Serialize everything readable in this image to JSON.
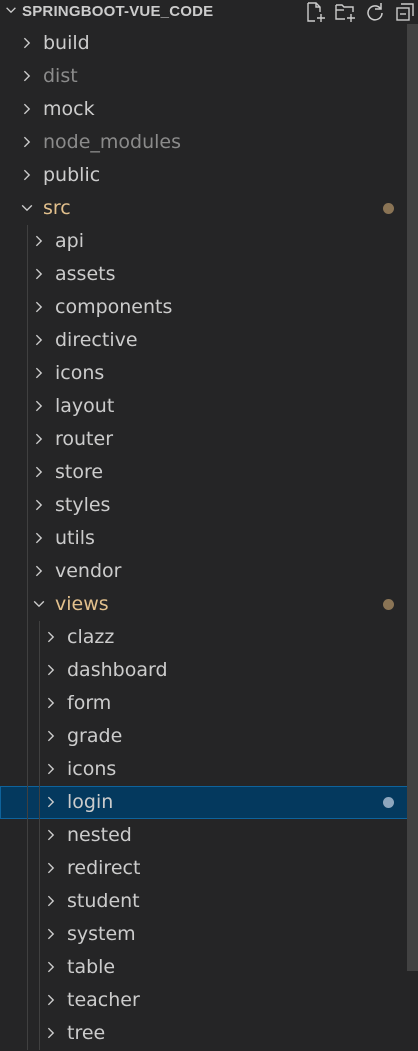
{
  "explorer": {
    "title": "SPRINGBOOT-VUE_CODE",
    "actions": [
      "new-file-icon",
      "new-folder-icon",
      "refresh-icon",
      "collapse-all-icon"
    ]
  },
  "tree": [
    {
      "label": "build",
      "depth": 0,
      "expanded": false,
      "dim": false,
      "modified": false
    },
    {
      "label": "dist",
      "depth": 0,
      "expanded": false,
      "dim": true,
      "modified": false
    },
    {
      "label": "mock",
      "depth": 0,
      "expanded": false,
      "dim": false,
      "modified": false
    },
    {
      "label": "node_modules",
      "depth": 0,
      "expanded": false,
      "dim": true,
      "modified": false
    },
    {
      "label": "public",
      "depth": 0,
      "expanded": false,
      "dim": false,
      "modified": false
    },
    {
      "label": "src",
      "depth": 0,
      "expanded": true,
      "dim": false,
      "modified": true
    },
    {
      "label": "api",
      "depth": 1,
      "expanded": false,
      "dim": false,
      "modified": false
    },
    {
      "label": "assets",
      "depth": 1,
      "expanded": false,
      "dim": false,
      "modified": false
    },
    {
      "label": "components",
      "depth": 1,
      "expanded": false,
      "dim": false,
      "modified": false
    },
    {
      "label": "directive",
      "depth": 1,
      "expanded": false,
      "dim": false,
      "modified": false
    },
    {
      "label": "icons",
      "depth": 1,
      "expanded": false,
      "dim": false,
      "modified": false
    },
    {
      "label": "layout",
      "depth": 1,
      "expanded": false,
      "dim": false,
      "modified": false
    },
    {
      "label": "router",
      "depth": 1,
      "expanded": false,
      "dim": false,
      "modified": false
    },
    {
      "label": "store",
      "depth": 1,
      "expanded": false,
      "dim": false,
      "modified": false
    },
    {
      "label": "styles",
      "depth": 1,
      "expanded": false,
      "dim": false,
      "modified": false
    },
    {
      "label": "utils",
      "depth": 1,
      "expanded": false,
      "dim": false,
      "modified": false
    },
    {
      "label": "vendor",
      "depth": 1,
      "expanded": false,
      "dim": false,
      "modified": false
    },
    {
      "label": "views",
      "depth": 1,
      "expanded": true,
      "dim": false,
      "modified": true
    },
    {
      "label": "clazz",
      "depth": 2,
      "expanded": false,
      "dim": false,
      "modified": false
    },
    {
      "label": "dashboard",
      "depth": 2,
      "expanded": false,
      "dim": false,
      "modified": false
    },
    {
      "label": "form",
      "depth": 2,
      "expanded": false,
      "dim": false,
      "modified": false
    },
    {
      "label": "grade",
      "depth": 2,
      "expanded": false,
      "dim": false,
      "modified": false
    },
    {
      "label": "icons",
      "depth": 2,
      "expanded": false,
      "dim": false,
      "modified": false
    },
    {
      "label": "login",
      "depth": 2,
      "expanded": false,
      "dim": false,
      "modified": true,
      "selected": true
    },
    {
      "label": "nested",
      "depth": 2,
      "expanded": false,
      "dim": false,
      "modified": false
    },
    {
      "label": "redirect",
      "depth": 2,
      "expanded": false,
      "dim": false,
      "modified": false
    },
    {
      "label": "student",
      "depth": 2,
      "expanded": false,
      "dim": false,
      "modified": false
    },
    {
      "label": "system",
      "depth": 2,
      "expanded": false,
      "dim": false,
      "modified": false
    },
    {
      "label": "table",
      "depth": 2,
      "expanded": false,
      "dim": false,
      "modified": false
    },
    {
      "label": "teacher",
      "depth": 2,
      "expanded": false,
      "dim": false,
      "modified": false
    },
    {
      "label": "tree",
      "depth": 2,
      "expanded": false,
      "dim": false,
      "modified": false
    }
  ],
  "colors": {
    "background": "#252526",
    "text": "#cccccc",
    "ignored": "#8b8b8b",
    "modified": "#e2c08d",
    "selection": "#04395e",
    "modified_dot": "#8a7455"
  }
}
